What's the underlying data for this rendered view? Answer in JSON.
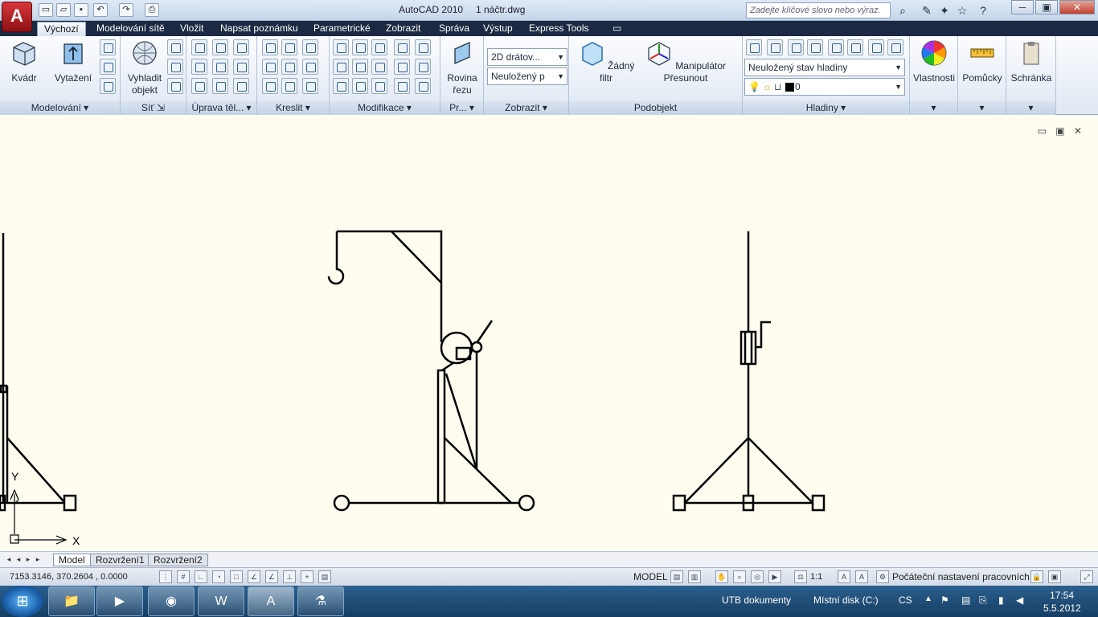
{
  "title": {
    "app": "AutoCAD 2010",
    "file": "1 náčtr.dwg"
  },
  "search": {
    "placeholder": "Zadejte klíčové slovo nebo výraz."
  },
  "ribbon_tabs": [
    "Výchozí",
    "Modelování sítě",
    "Vložit",
    "Napsat poznámku",
    "Parametrické",
    "Zobrazit",
    "Správa",
    "Výstup",
    "Express Tools"
  ],
  "panels": {
    "modelovani": {
      "label": "Modelování",
      "kvadr": "Kvádr",
      "vytazeni": "Vytažení"
    },
    "sit": {
      "label": "Síť",
      "vyhladit_1": "Vyhladit",
      "vyhladit_2": "objekt"
    },
    "uprava": {
      "label": "Úprava těl..."
    },
    "kreslit": {
      "label": "Kreslit"
    },
    "modifikace": {
      "label": "Modifikace"
    },
    "pr": {
      "label": "Pr...",
      "rovina_1": "Rovina",
      "rovina_2": "řezu"
    },
    "zobrazit": {
      "label": "Zobrazit",
      "visual_style": "2D drátov...",
      "view": "Neuložený p"
    },
    "podobjekt": {
      "label": "Podobjekt",
      "filtr": "Žádný filtr",
      "manipulator": "Manipulátor Přesunout"
    },
    "hladiny": {
      "label": "Hladiny",
      "state": "Neuložený stav hladiny",
      "layer": "0"
    },
    "vlastnosti": {
      "label": "Vlastnosti"
    },
    "pomucky": {
      "label": "Pomůcky"
    },
    "schranka": {
      "label": "Schránka"
    }
  },
  "ucs": {
    "x": "X",
    "y": "Y"
  },
  "layout_tabs": [
    "Model",
    "Rozvržení1",
    "Rozvržení2"
  ],
  "status": {
    "coords": "7153.3146, 370.2604 , 0.0000",
    "model": "MODEL",
    "scale": "1:1",
    "workspace": "Počáteční nastavení pracovních"
  },
  "taskbar": {
    "utb": "UTB dokumenty",
    "disk": "Místní disk (C:)",
    "lang": "CS",
    "time": "17:54",
    "date": "5.5.2012"
  },
  "icons": {
    "app": "autocad-logo",
    "search": "binoculars-icon",
    "help": "help-icon"
  }
}
